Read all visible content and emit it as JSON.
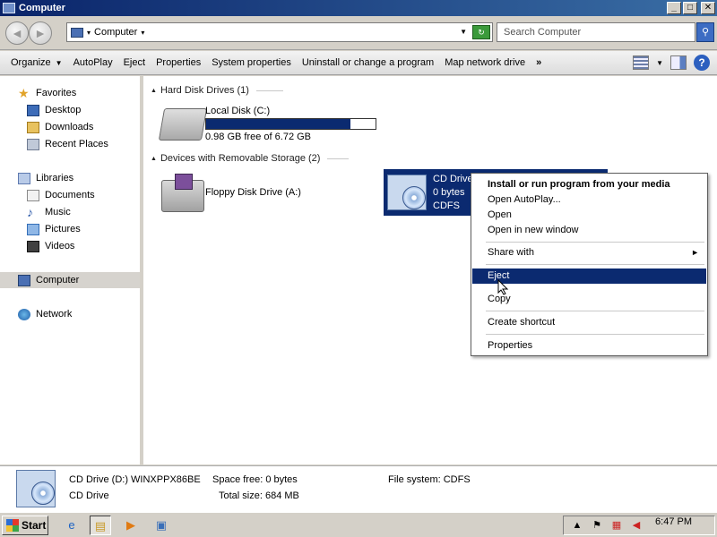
{
  "window": {
    "title": "Computer",
    "min_glyph": "_",
    "max_glyph": "□",
    "close_glyph": "✕"
  },
  "address": {
    "path": "Computer",
    "search_placeholder": "Search Computer"
  },
  "command_bar": {
    "items": [
      "Organize",
      "AutoPlay",
      "Eject",
      "Properties",
      "System properties",
      "Uninstall or change a program",
      "Map network drive"
    ],
    "more": "»"
  },
  "sidebar": {
    "favorites": "Favorites",
    "desktop": "Desktop",
    "downloads": "Downloads",
    "recent_places": "Recent Places",
    "libraries": "Libraries",
    "documents": "Documents",
    "music": "Music",
    "pictures": "Pictures",
    "videos": "Videos",
    "computer": "Computer",
    "network": "Network"
  },
  "main": {
    "group_hdd": "Hard Disk Drives (1)",
    "group_removable": "Devices with Removable Storage (2)",
    "local_disk": {
      "name": "Local Disk (C:)",
      "free": "0.98 GB free of 6.72 GB",
      "used_fraction": 0.854
    },
    "floppy": {
      "name": "Floppy Disk Drive (A:)"
    },
    "cd": {
      "name": "CD Drive",
      "free": "0 bytes",
      "fs": "CDFS"
    }
  },
  "context_menu": {
    "install": "Install or run program from your media",
    "open_autoplay": "Open AutoPlay...",
    "open": "Open",
    "open_new_window": "Open in new window",
    "share_with": "Share with",
    "eject": "Eject",
    "copy": "Copy",
    "create_shortcut": "Create shortcut",
    "properties": "Properties"
  },
  "details": {
    "name": "CD Drive (D:) WINXPPX86BE",
    "type": "CD Drive",
    "space_free": "Space free: 0 bytes",
    "total_size": "Total size: 684 MB",
    "file_system": "File system: CDFS"
  },
  "taskbar": {
    "start": "Start",
    "clock": "6:47 PM"
  },
  "colors": {
    "selection": "#0b2a70",
    "title_start": "#0a246a",
    "title_end": "#3a6ea5"
  },
  "icons": [
    "computer-icon",
    "back-icon",
    "forward-icon",
    "refresh-icon",
    "search-icon",
    "views-icon",
    "preview-pane-icon",
    "help-icon",
    "star-icon",
    "hard-disk-icon",
    "floppy-drive-icon",
    "cd-drive-icon",
    "ie-icon",
    "explorer-icon",
    "media-player-icon",
    "network-adapter-icon",
    "flag-icon",
    "volume-icon"
  ]
}
